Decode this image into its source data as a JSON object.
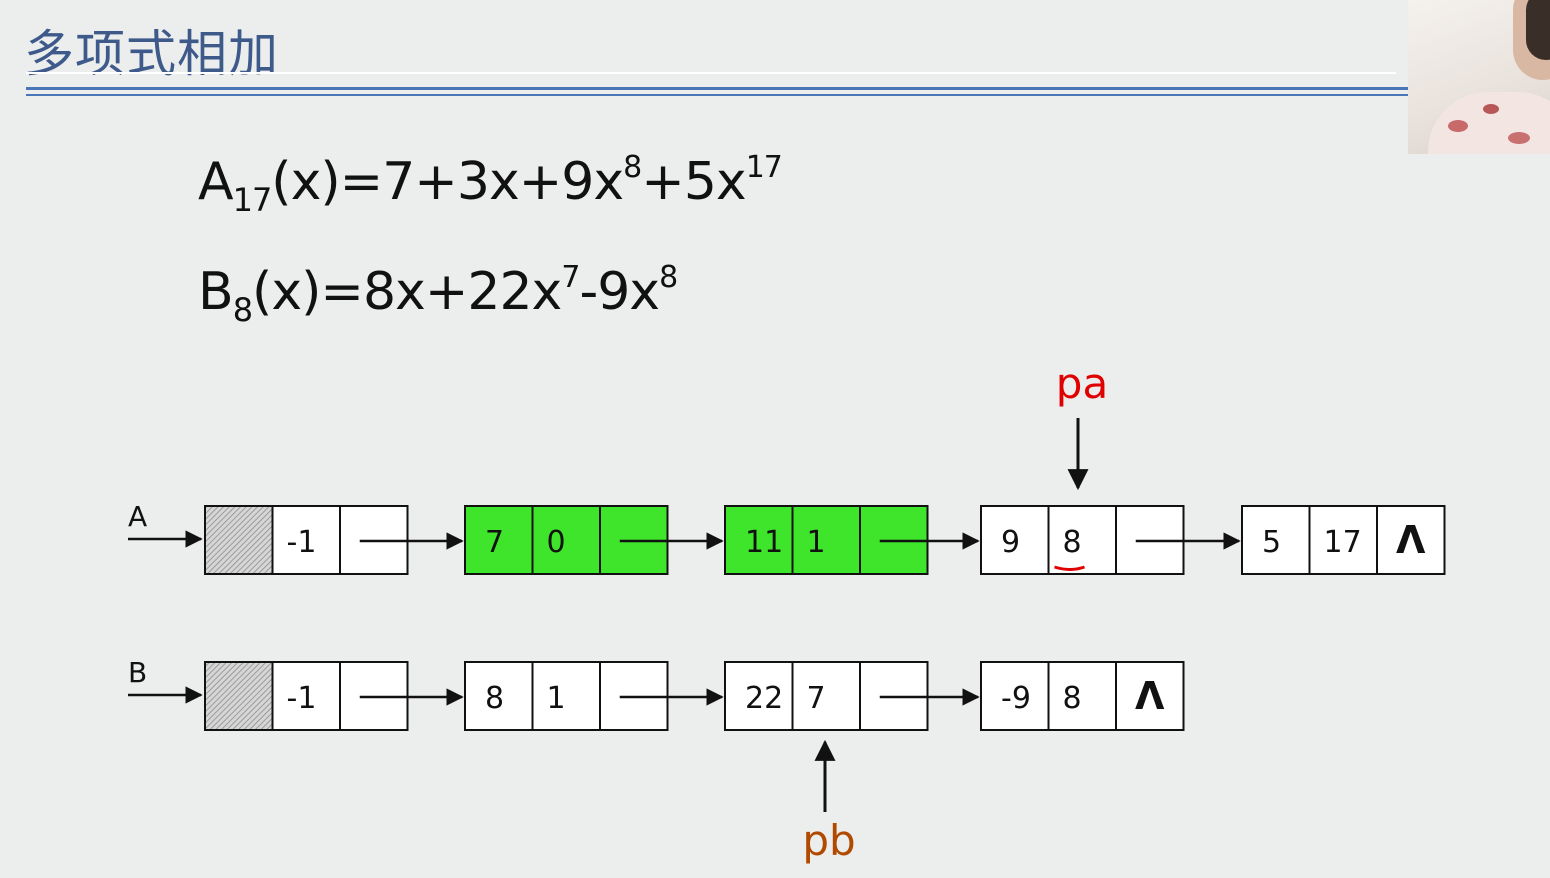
{
  "title": "多项式相加",
  "formulas": {
    "a": {
      "name": "A",
      "name_sub": "17",
      "pre": "(x)=7+3x+9x",
      "exp1": "8",
      "mid": "+5x",
      "exp2": "17"
    },
    "b": {
      "name": "B",
      "name_sub": "8",
      "pre": "(x)=8x+22x",
      "exp1": "7",
      "mid": "-9x",
      "exp2": "8"
    }
  },
  "lists": [
    {
      "label": "A",
      "nodes": [
        {
          "head": true,
          "coef": "",
          "exp": "-1",
          "next": ""
        },
        {
          "coef": "7",
          "exp": "0",
          "next": "",
          "highlight": true
        },
        {
          "coef": "11",
          "exp": "1",
          "next": "",
          "highlight": true
        },
        {
          "coef": "9",
          "exp": "8",
          "next": "",
          "underline_exp": true
        },
        {
          "coef": "5",
          "exp": "17",
          "next": "Λ"
        }
      ]
    },
    {
      "label": "B",
      "nodes": [
        {
          "head": true,
          "coef": "",
          "exp": "-1",
          "next": ""
        },
        {
          "coef": "8",
          "exp": "1",
          "next": ""
        },
        {
          "coef": "22",
          "exp": "7",
          "next": ""
        },
        {
          "coef": "-9",
          "exp": "8",
          "next": "Λ"
        }
      ]
    }
  ],
  "pointers": {
    "pa": {
      "label": "pa",
      "list": 0,
      "node": 3,
      "color": "#e00000"
    },
    "pb": {
      "label": "pb",
      "list": 1,
      "node": 2,
      "color": "#b04a00"
    }
  },
  "colors": {
    "highlight": "#3ee52b",
    "head_hatch": "#9a9a9a",
    "title": "#3d5a8a",
    "rule": "#4a76b7"
  }
}
